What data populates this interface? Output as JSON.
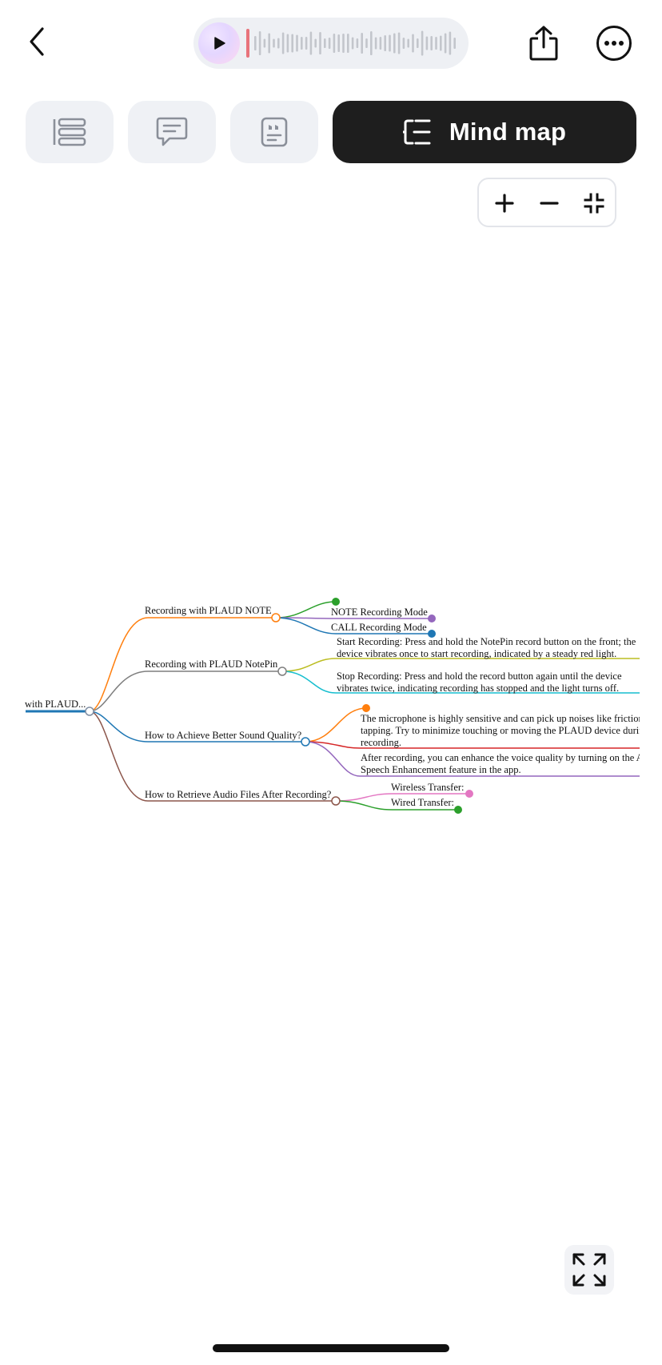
{
  "tabs": {
    "mindmap_label": "Mind map"
  },
  "mindmap": {
    "root": "with PLAUD...",
    "branches": [
      {
        "label": "Recording with PLAUD NOTE"
      },
      {
        "label": "Recording with PLAUD NotePin"
      },
      {
        "label": "How to Achieve Better Sound Quality?"
      },
      {
        "label": "How to Retrieve Audio Files After Recording?"
      }
    ],
    "leaves": {
      "note_mode": "NOTE Recording Mode",
      "call_mode": "CALL Recording Mode",
      "start_line1": "Start Recording: Press and hold the NotePin record button on the front; the",
      "start_line2": "device vibrates once to start recording, indicated by a steady red light.",
      "stop_line1": "Stop Recording: Press and hold the record button again until the device",
      "stop_line2": "vibrates twice, indicating recording has stopped and the light turns off.",
      "mic_line1": "The microphone is highly sensitive and can pick up noises like friction",
      "mic_line2": "tapping. Try to minimize touching or moving the PLAUD device durin",
      "mic_line3": "recording.",
      "after_line1": "After recording, you can enhance the voice quality by turning on the A",
      "after_line2": "Speech Enhancement feature in the app.",
      "wireless": "Wireless Transfer:",
      "wired": "Wired Transfer:"
    }
  },
  "colors": {
    "dark": "#1e1e1e",
    "tab_bg": "#eff1f5",
    "icon_gray": "#8a8f99"
  }
}
